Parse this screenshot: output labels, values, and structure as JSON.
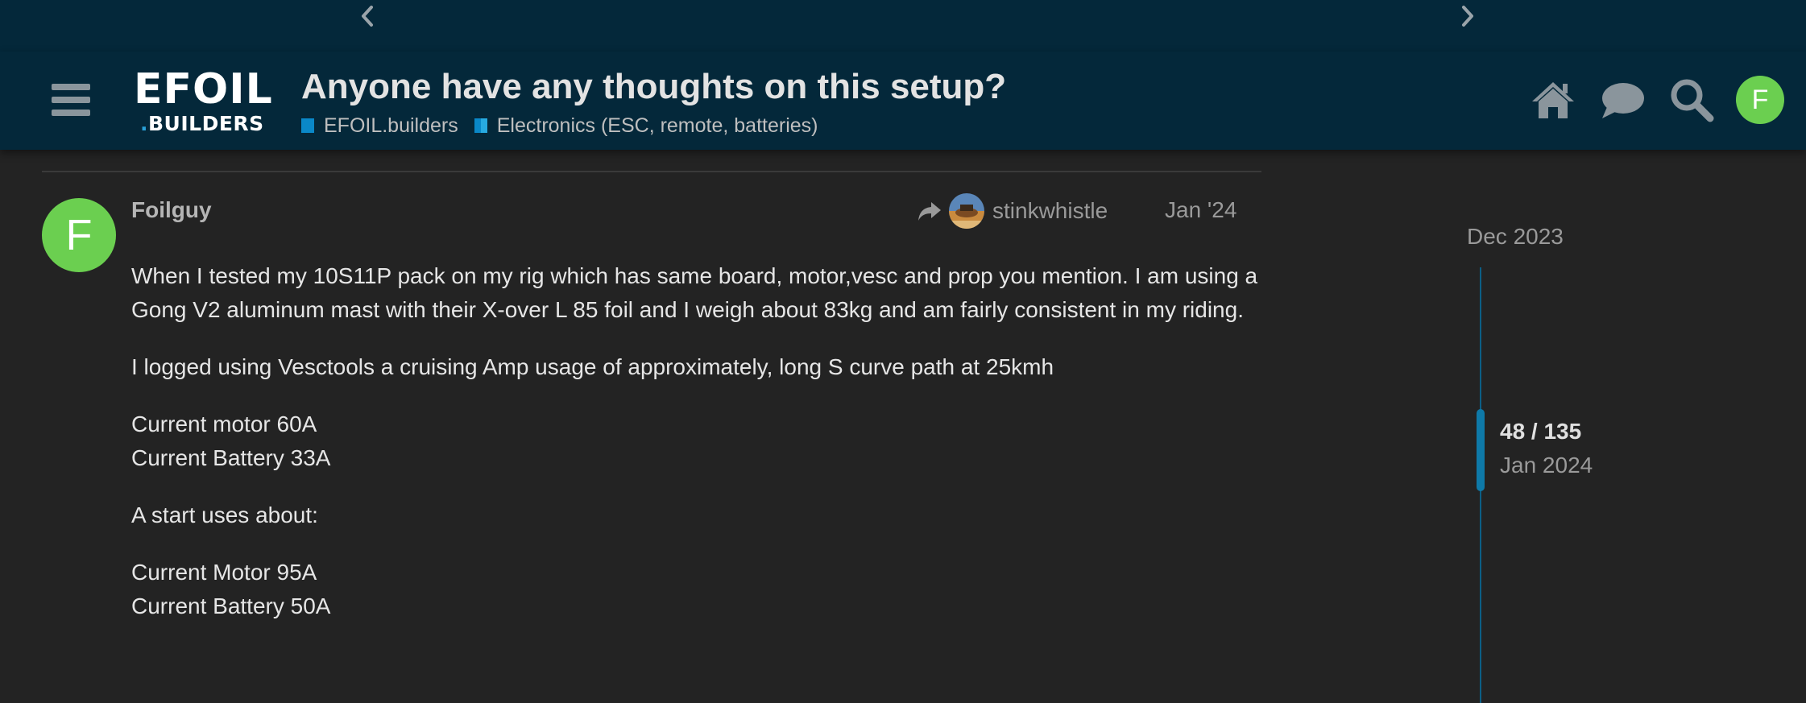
{
  "nav": {
    "prev_icon": "chevron-left-icon",
    "next_icon": "chevron-right-icon"
  },
  "header": {
    "logo_top": "EFOIL",
    "logo_bottom_dot": ".",
    "logo_bottom": "BUILDERS",
    "title": "Anyone have any thoughts on this setup?",
    "categories": [
      {
        "label": "EFOIL.builders",
        "color": "#0a88c8"
      },
      {
        "label": "Electronics (ESC, remote, batteries)",
        "colors": [
          "#0a88c8",
          "#27aae1"
        ]
      }
    ],
    "icons": [
      "home-icon",
      "chat-icon",
      "search-icon"
    ],
    "user_initial": "F",
    "user_avatar_color": "#6bcf50"
  },
  "post": {
    "avatar_initial": "F",
    "avatar_color": "#6bcf50",
    "username": "Foilguy",
    "reply_to": "stinkwhistle",
    "date": "Jan '24",
    "paragraphs": [
      [
        "When I tested my 10S11P pack on my rig which has same board, motor,vesc and prop you mention. I am using a Gong V2 aluminum mast with their X-over L 85 foil and I weigh about 83kg and am fairly consistent in my riding."
      ],
      [
        "I logged using Vesctools a cruising Amp usage of approximately, long S curve path at 25kmh"
      ],
      [
        "Current motor 60A",
        "Current Battery 33A"
      ],
      [
        "A start uses about:"
      ],
      [
        "Current Motor 95A",
        "Current Battery 50A"
      ]
    ]
  },
  "timeline": {
    "start_label": "Dec 2023",
    "position": 48,
    "total": 135,
    "position_text": "48 / 135",
    "current_date": "Jan 2024",
    "color": "#0e79a8"
  }
}
